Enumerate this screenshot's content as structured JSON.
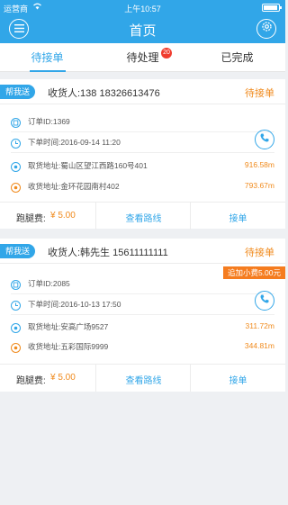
{
  "status_bar": {
    "carrier": "运营商",
    "time": "上午10:57"
  },
  "nav": {
    "title": "首页"
  },
  "tabs": [
    {
      "label": "待接单",
      "active": true
    },
    {
      "label": "待处理",
      "badge": "20"
    },
    {
      "label": "已完成"
    }
  ],
  "orders": [
    {
      "tag": "帮我送",
      "receiver": "收货人:138 18326613476",
      "status": "待接单",
      "order_id": "订单ID:1369",
      "order_time": "下单时间:2016-09-14 11:20",
      "pickup": "取货地址:蜀山区望江西路160号401",
      "pickup_dist": "916.58m",
      "delivery": "收货地址:金环花园南村402",
      "delivery_dist": "793.67m",
      "fee_label": "跑腿费:",
      "fee": "¥ 5.00",
      "route_label": "查看路线",
      "accept_label": "接单"
    },
    {
      "tag": "帮我送",
      "receiver": "收货人:韩先生 15611111111",
      "status": "待接单",
      "extra_fee": "追加小费5.00元",
      "order_id": "订单ID:2085",
      "order_time": "下单时间:2016-10-13 17:50",
      "pickup": "取货地址:安高广场9527",
      "pickup_dist": "311.72m",
      "delivery": "收货地址:五彩国际9999",
      "delivery_dist": "344.81m",
      "fee_label": "跑腿费:",
      "fee": "¥ 5.00",
      "route_label": "查看路线",
      "accept_label": "接单"
    }
  ],
  "colors": {
    "primary": "#31a6e8",
    "accent": "#f08a1c",
    "badge": "#f03c2e"
  },
  "icons": [
    "menu-icon",
    "settings-icon",
    "wifi-icon",
    "order-id-icon",
    "clock-icon",
    "location-icon",
    "phone-icon"
  ]
}
